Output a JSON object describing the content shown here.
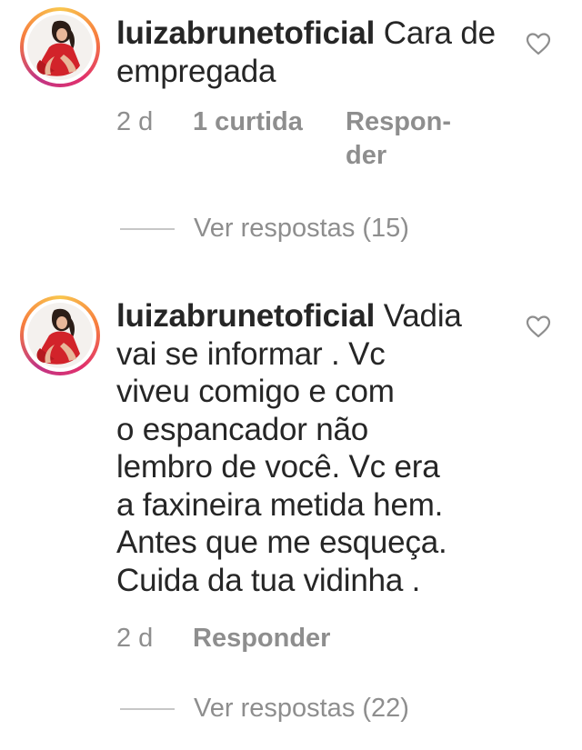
{
  "comments": [
    {
      "username": "luizabrunetoficial",
      "text": "Cara de empregada",
      "time": "2 d",
      "likes": "1 curtida",
      "reply_label_line1": "Respon-",
      "reply_label_line2": "der",
      "view_replies": "Ver respostas (15)"
    },
    {
      "username": "luizabrunetoficial",
      "text_lines": [
        "Vadia",
        "vai se informar . Vc",
        "viveu comigo e com",
        "o espancador não",
        "lembro de você. Vc era",
        "a faxineira metida hem.",
        "Antes que me esqueça.",
        "Cuida da tua vidinha ."
      ],
      "time": "2 d",
      "reply_label": "Responder",
      "view_replies": "Ver respostas (22)"
    }
  ],
  "colors": {
    "text": "#262626",
    "secondary": "#8e8e8e",
    "divider": "#c7c7c7",
    "story_ring": "#e1306c",
    "avatar_dress": "#d2232a"
  },
  "icons": {
    "like": "heart-outline-icon"
  }
}
